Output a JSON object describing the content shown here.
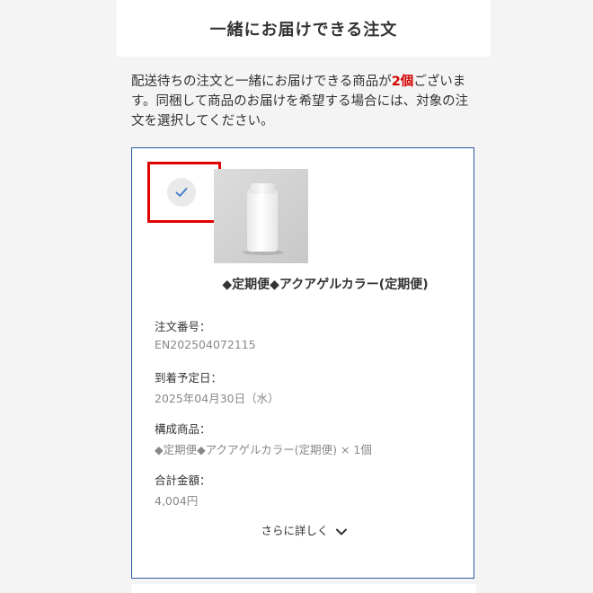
{
  "header": {
    "title": "一緒にお届けできる注文"
  },
  "intro": {
    "text_before": "配送待ちの注文と一緒にお届けできる商品が",
    "count": "2個",
    "text_after": "ございます。同梱して商品のお届けを希望する場合には、対象の注文を選択してください。"
  },
  "order": {
    "selected": true,
    "product_name": "◆定期便◆アクアゲルカラー(定期便)",
    "order_number_label": "注文番号：",
    "order_number": "EN202504072115",
    "arrival_label": "到着予定日：",
    "arrival_date": "2025年04月30日（水）",
    "items_label": "構成商品：",
    "items_value": "◆定期便◆アクアゲルカラー(定期便) × 1個",
    "total_label": "合計金額：",
    "total_value": "4,004円",
    "more_label": "さらに詳しく"
  },
  "colors": {
    "card_border": "#2e5aa7",
    "highlight": "#e00000",
    "count_accent": "#d40000",
    "check": "#3a78c9"
  }
}
